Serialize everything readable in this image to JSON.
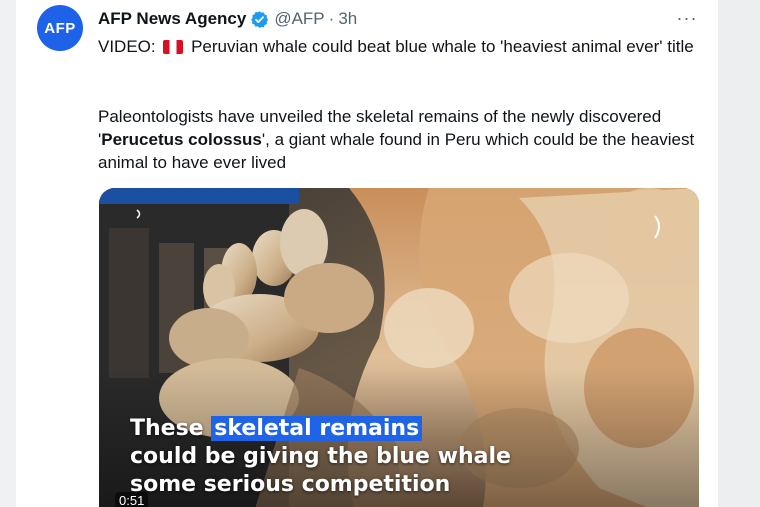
{
  "tweet": {
    "avatar_text": "AFP",
    "display_name": "AFP News Agency",
    "handle": "@AFP",
    "separator": "·",
    "time": "3h",
    "more_label": "···",
    "text_line1_before_flag": "VIDEO: ",
    "text_line1_after_flag": " Peruvian whale could beat blue whale to 'heaviest animal ever' title",
    "text_p2_before": "Paleontologists have unveiled the skeletal remains of the newly discovered '",
    "text_p2_bold": "Perucetus colossus",
    "text_p2_after": "', a giant whale found in Peru which could be the heaviest animal to have ever lived"
  },
  "video": {
    "caption_pre": "These ",
    "caption_highlight": "skeletal remains",
    "caption_line2": "could be giving the blue whale",
    "caption_line3": "some serious competition",
    "duration": "0:51"
  },
  "colors": {
    "avatar_bg": "#1d62e8",
    "verified": "#1d9bf0",
    "caption_highlight": "#1f63e6",
    "secondary_text": "#536471"
  },
  "icons": {
    "verified": "verified-badge-icon",
    "flag": "peru-flag-icon",
    "more": "more-horizontal-icon"
  }
}
